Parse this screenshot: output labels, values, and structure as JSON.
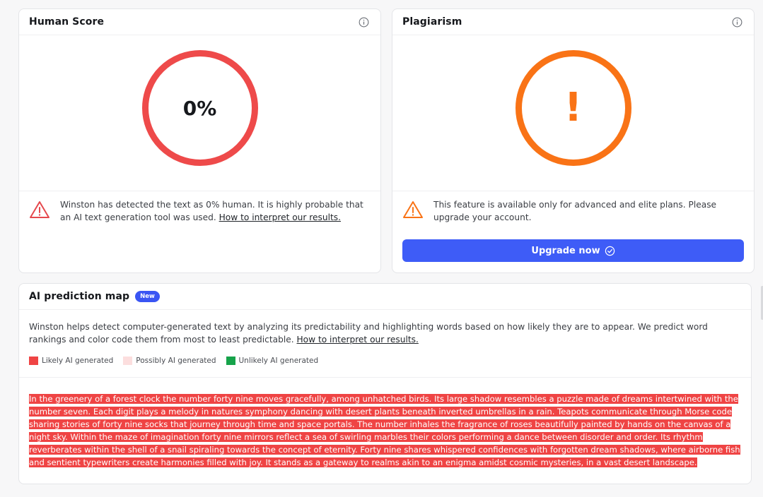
{
  "human_score": {
    "title": "Human Score",
    "value": "0%",
    "ring_color": "#ee4a4a",
    "message": "Winston has detected the text as 0% human. It is highly probable that an AI text generation tool was used.",
    "link": "How to interpret our results."
  },
  "plagiarism": {
    "title": "Plagiarism",
    "symbol": "!",
    "ring_color": "#f97316",
    "message": "This feature is available only for advanced and elite plans. Please upgrade your account.",
    "button": "Upgrade now"
  },
  "prediction_map": {
    "title": "AI prediction map",
    "badge": "New",
    "description": "Winston helps detect computer-generated text by analyzing its predictability and highlighting words based on how likely they are to appear. We predict word rankings and color code them from most to least predictable.",
    "link": "How to interpret our results.",
    "legend": [
      {
        "label": "Likely AI generated",
        "color": "#ef4444"
      },
      {
        "label": "Possibly AI generated",
        "color": "#fcdede"
      },
      {
        "label": "Unlikely AI generated",
        "color": "#16a34a"
      }
    ],
    "text": "In the greenery of a forest clock the number forty nine moves gracefully, among unhatched birds. Its large shadow resembles a puzzle made of dreams intertwined with the number seven. Each digit plays a melody in natures symphony dancing with desert plants beneath inverted umbrellas in a rain. Teapots communicate through Morse code sharing stories of forty nine socks that journey through time and space portals. The number inhales the fragrance of roses beautifully painted by hands on the canvas of a night sky. Within the maze of imagination forty nine mirrors reflect a sea of swirling marbles their colors performing a dance between disorder and order. Its rhythm reverberates within the shell of a snail spiraling towards the concept of eternity. Forty nine shares whispered confidences with forgotten dream shadows, where airborne fish and sentient typewriters create harmonies filled with joy. It stands as a gateway to realms akin to an enigma amidst cosmic mysteries, in a vast desert landscape."
  }
}
